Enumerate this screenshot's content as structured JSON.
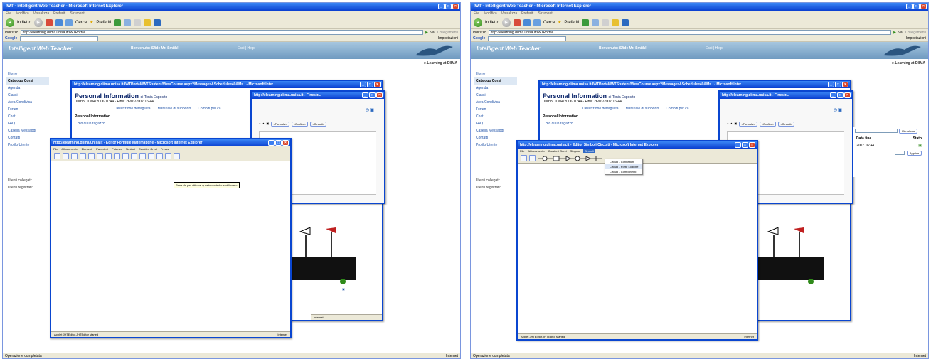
{
  "ie": {
    "window_title": "IWT - Intelligent Web Teacher - Microsoft Internet Explorer",
    "menu": [
      "File",
      "Modifica",
      "Visualizza",
      "Preferiti",
      "Strumenti",
      "?"
    ],
    "back_label": "Indietro",
    "search_label": "Cerca",
    "favorites_label": "Preferiti",
    "address_label": "Indirizzo",
    "address_value": "http://elearning.diima.unisa.it/IWTPortal/",
    "go_label": "Vai",
    "links_label": "Collegamenti",
    "google_label": "Google",
    "settings_label": "Impostazioni",
    "status_done": "Operazione completata",
    "status_zone": "Internet"
  },
  "portal": {
    "logo": "Intelligent Web Teacher",
    "welcome": "Benvenuto: Sfide Mr. Smith!",
    "exit": "Esci | Help",
    "elearning": "e-Learning at DIIMA",
    "sidebar": [
      "Home",
      "Catalogo Corsi",
      "Agenda",
      "Classi",
      "Area Condivisa",
      "Forum",
      "Chat",
      "FAQ",
      "Casella Messaggi",
      "Contatti",
      "Profilo Utente"
    ],
    "users": [
      "Utenti collegati:",
      "Utenti registrati:"
    ],
    "table_header": [
      "Data fine",
      "Stato"
    ],
    "table_row": "2007 16:44",
    "apply_label": "Applica",
    "view_label": "Visualizza"
  },
  "course_window": {
    "title": "http://elearning.diima.unisa.it/IWTPortal/IWTStudent/ViewCourse.aspx?Message=&Schedule=40&M=...- Microsoft Inter...",
    "heading": "Personal Information",
    "author": "di Tonia Esposito",
    "dates": "Inizio: 10/04/2006 11:44 - Fine: 26/03/2007 16:44",
    "tabs": [
      "Descrizione dettagliata",
      "Materiale di supporto",
      "Compiti per ca"
    ],
    "section": "Personal Information",
    "subsection": "Bio di un ragazzo"
  },
  "popup_window": {
    "title": "http://elearning.diima.unisa.it - Finestr...",
    "buttons": [
      "<Formula>",
      "<Grafico>",
      "<Circuiti>"
    ]
  },
  "math_editor": {
    "title": "http://elearning.diima.unisa.it - Editor Formule Matematiche - Microsoft Internet Explorer",
    "menu": [
      "File",
      "Allineamento",
      "Elementi",
      "Parentesi",
      "Potenze",
      "Simboli",
      "Caratteri Greci",
      "Frecce"
    ],
    "tooltip": "Pane da per attivare questo controllo e utilizzarlo",
    "status": "Applet JHTEditor.JHTEditor started",
    "zone": "Internet"
  },
  "circuit_editor": {
    "title": "http://elearning.diima.unisa.it - Editor Simboli Circuiti - Microsoft Internet Explorer",
    "menu": [
      "File",
      "Allineamento",
      "Caratteri Greci",
      "Singolo",
      "Simboli"
    ],
    "dropdown": [
      "Circuiti - Connettori",
      "Circuiti - Porte Logiche",
      "Circuiti - Componenti"
    ],
    "status": "Applet JHTEditor.JHTEditor started",
    "zone": "Internet"
  },
  "colors": {
    "xp_blue": "#0a46d0",
    "accent_green": "#2f8a1a",
    "banner": "#6f9ac0"
  }
}
